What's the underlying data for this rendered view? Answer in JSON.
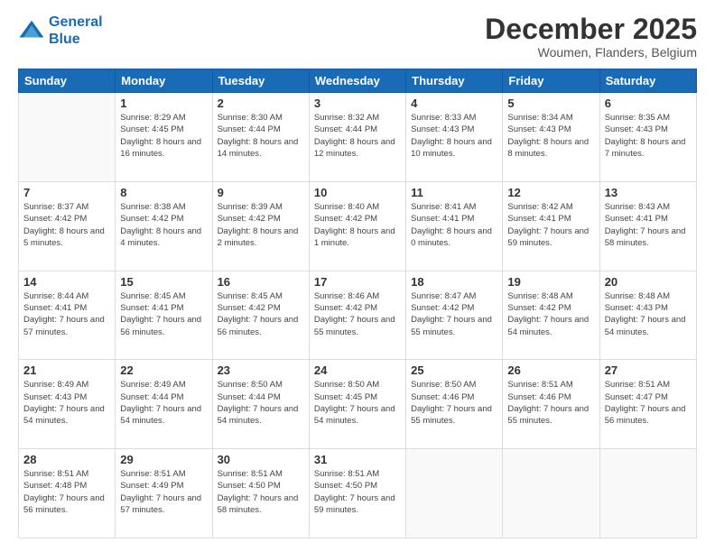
{
  "header": {
    "logo_line1": "General",
    "logo_line2": "Blue",
    "month": "December 2025",
    "location": "Woumen, Flanders, Belgium"
  },
  "days_of_week": [
    "Sunday",
    "Monday",
    "Tuesday",
    "Wednesday",
    "Thursday",
    "Friday",
    "Saturday"
  ],
  "weeks": [
    [
      {
        "day": "",
        "sunrise": "",
        "sunset": "",
        "daylight": ""
      },
      {
        "day": "1",
        "sunrise": "8:29 AM",
        "sunset": "4:45 PM",
        "daylight": "8 hours and 16 minutes."
      },
      {
        "day": "2",
        "sunrise": "8:30 AM",
        "sunset": "4:44 PM",
        "daylight": "8 hours and 14 minutes."
      },
      {
        "day": "3",
        "sunrise": "8:32 AM",
        "sunset": "4:44 PM",
        "daylight": "8 hours and 12 minutes."
      },
      {
        "day": "4",
        "sunrise": "8:33 AM",
        "sunset": "4:43 PM",
        "daylight": "8 hours and 10 minutes."
      },
      {
        "day": "5",
        "sunrise": "8:34 AM",
        "sunset": "4:43 PM",
        "daylight": "8 hours and 8 minutes."
      },
      {
        "day": "6",
        "sunrise": "8:35 AM",
        "sunset": "4:43 PM",
        "daylight": "8 hours and 7 minutes."
      }
    ],
    [
      {
        "day": "7",
        "sunrise": "8:37 AM",
        "sunset": "4:42 PM",
        "daylight": "8 hours and 5 minutes."
      },
      {
        "day": "8",
        "sunrise": "8:38 AM",
        "sunset": "4:42 PM",
        "daylight": "8 hours and 4 minutes."
      },
      {
        "day": "9",
        "sunrise": "8:39 AM",
        "sunset": "4:42 PM",
        "daylight": "8 hours and 2 minutes."
      },
      {
        "day": "10",
        "sunrise": "8:40 AM",
        "sunset": "4:42 PM",
        "daylight": "8 hours and 1 minute."
      },
      {
        "day": "11",
        "sunrise": "8:41 AM",
        "sunset": "4:41 PM",
        "daylight": "8 hours and 0 minutes."
      },
      {
        "day": "12",
        "sunrise": "8:42 AM",
        "sunset": "4:41 PM",
        "daylight": "7 hours and 59 minutes."
      },
      {
        "day": "13",
        "sunrise": "8:43 AM",
        "sunset": "4:41 PM",
        "daylight": "7 hours and 58 minutes."
      }
    ],
    [
      {
        "day": "14",
        "sunrise": "8:44 AM",
        "sunset": "4:41 PM",
        "daylight": "7 hours and 57 minutes."
      },
      {
        "day": "15",
        "sunrise": "8:45 AM",
        "sunset": "4:41 PM",
        "daylight": "7 hours and 56 minutes."
      },
      {
        "day": "16",
        "sunrise": "8:45 AM",
        "sunset": "4:42 PM",
        "daylight": "7 hours and 56 minutes."
      },
      {
        "day": "17",
        "sunrise": "8:46 AM",
        "sunset": "4:42 PM",
        "daylight": "7 hours and 55 minutes."
      },
      {
        "day": "18",
        "sunrise": "8:47 AM",
        "sunset": "4:42 PM",
        "daylight": "7 hours and 55 minutes."
      },
      {
        "day": "19",
        "sunrise": "8:48 AM",
        "sunset": "4:42 PM",
        "daylight": "7 hours and 54 minutes."
      },
      {
        "day": "20",
        "sunrise": "8:48 AM",
        "sunset": "4:43 PM",
        "daylight": "7 hours and 54 minutes."
      }
    ],
    [
      {
        "day": "21",
        "sunrise": "8:49 AM",
        "sunset": "4:43 PM",
        "daylight": "7 hours and 54 minutes."
      },
      {
        "day": "22",
        "sunrise": "8:49 AM",
        "sunset": "4:44 PM",
        "daylight": "7 hours and 54 minutes."
      },
      {
        "day": "23",
        "sunrise": "8:50 AM",
        "sunset": "4:44 PM",
        "daylight": "7 hours and 54 minutes."
      },
      {
        "day": "24",
        "sunrise": "8:50 AM",
        "sunset": "4:45 PM",
        "daylight": "7 hours and 54 minutes."
      },
      {
        "day": "25",
        "sunrise": "8:50 AM",
        "sunset": "4:46 PM",
        "daylight": "7 hours and 55 minutes."
      },
      {
        "day": "26",
        "sunrise": "8:51 AM",
        "sunset": "4:46 PM",
        "daylight": "7 hours and 55 minutes."
      },
      {
        "day": "27",
        "sunrise": "8:51 AM",
        "sunset": "4:47 PM",
        "daylight": "7 hours and 56 minutes."
      }
    ],
    [
      {
        "day": "28",
        "sunrise": "8:51 AM",
        "sunset": "4:48 PM",
        "daylight": "7 hours and 56 minutes."
      },
      {
        "day": "29",
        "sunrise": "8:51 AM",
        "sunset": "4:49 PM",
        "daylight": "7 hours and 57 minutes."
      },
      {
        "day": "30",
        "sunrise": "8:51 AM",
        "sunset": "4:50 PM",
        "daylight": "7 hours and 58 minutes."
      },
      {
        "day": "31",
        "sunrise": "8:51 AM",
        "sunset": "4:50 PM",
        "daylight": "7 hours and 59 minutes."
      },
      {
        "day": "",
        "sunrise": "",
        "sunset": "",
        "daylight": ""
      },
      {
        "day": "",
        "sunrise": "",
        "sunset": "",
        "daylight": ""
      },
      {
        "day": "",
        "sunrise": "",
        "sunset": "",
        "daylight": ""
      }
    ]
  ]
}
